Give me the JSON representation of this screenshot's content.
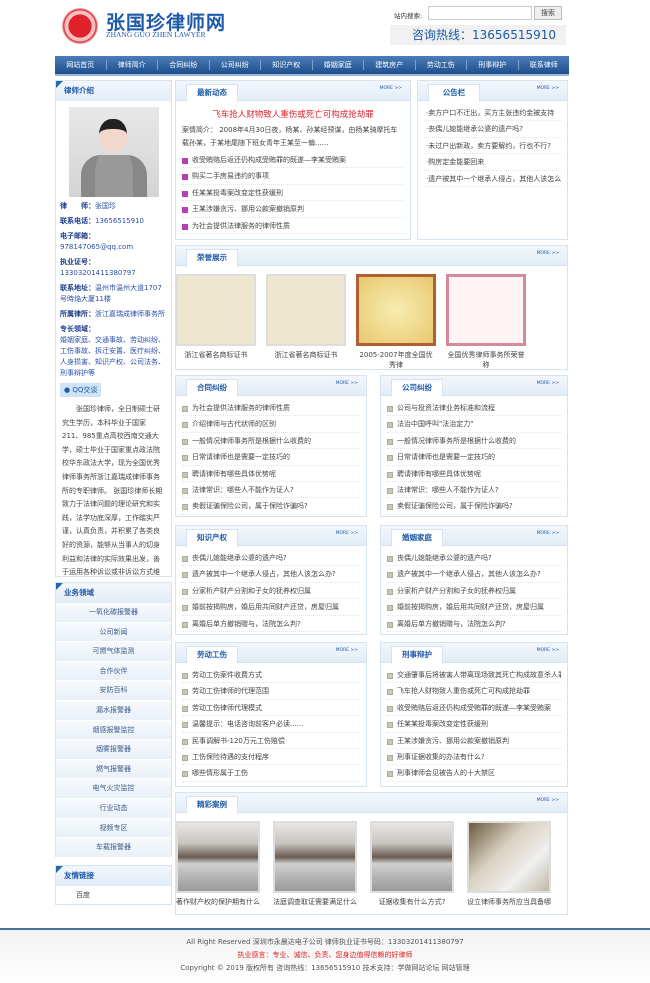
{
  "header": {
    "title": "张国珍律师网",
    "subtitle": "ZHANG GUO ZHEN LAWYER",
    "search_label": "站内搜索:",
    "search_value": "",
    "search_button": "搜索",
    "hotline": "咨询热线：13656515910"
  },
  "nav": [
    "网站首页",
    "律师简介",
    "合同纠纷",
    "公司纠纷",
    "知识产权",
    "婚姻家庭",
    "建筑房产",
    "劳动工伤",
    "刑事辩护",
    "联系律师"
  ],
  "sidebar": {
    "intro_title": "律师介绍",
    "info": [
      {
        "label": "律　　师：",
        "value": "张国珍"
      },
      {
        "label": "联系电话：",
        "value": "13656515910"
      },
      {
        "label": "电子邮箱：",
        "value": "978147065@qq.com"
      },
      {
        "label": "执业证号：",
        "value": "13303201411380797"
      },
      {
        "label": "联系地址：",
        "value": "温州市温州大道1707号時焔大厦11楼"
      },
      {
        "label": "所属律所：",
        "value": "浙江嘉瑞成律师事务所"
      },
      {
        "label": "专长领域：",
        "value": "婚姻家庭、交通事故、劳动纠纷、工伤事故、拆迁安置、医疗纠纷、人身损害、知识产权、公司法务、刑事辩护等"
      }
    ],
    "qq_label": "QQ交谈",
    "bio": "张国珍律师，全日制硕士研究生学历，本科毕业于国家211、985重点高校西南交通大学，硕士毕业于国家重点政法院校华东政法大学，现为全国优秀律师事务所浙江嘉瑞成律师事务所的专职律师。 张国珍律师长期致力于法律问题的理论研究和实践，法学功底深厚，工作踏实严谨，认真负责，并积累了各类良好的资源，能够从当事人的切身利益和法律的实际效果出发，善于运用各种诉讼或非诉讼方式维护当事人的合法权益，并力图将当事人的利益最大化。",
    "business_title": "业务领域",
    "business": [
      "一氧化碳报警器",
      "公司新闻",
      "可燃气体监测",
      "合作伙伴",
      "安防百科",
      "漏水报警器",
      "烟感报警监控",
      "烟雾报警器",
      "燃气报警器",
      "电气火灾监控",
      "行业动态",
      "视频专区",
      "车载报警器"
    ],
    "links_title": "友情链接",
    "links": [
      "百度"
    ]
  },
  "more": "MORE >>",
  "news": {
    "title": "最新动态",
    "headline": "飞车抢人财物致人重伤或死亡可构成抢劫罪",
    "summary": "案情简介： 2008年4月30日夜，杨某、孙某经预谋，由杨某骑摩托车载孙某，于某地尾随下班女青年王某至一偏......",
    "items": [
      "收受贿赂后返还仍构成受贿罪的既遂—李某受贿案",
      "购买二手房易违约的事项",
      "任某某投毒案改变定性获缓刑",
      "王某涉嫌贪污、挪用公款案撤销原判",
      "为社会提供法律服务的律师性质"
    ]
  },
  "notice": {
    "title": "公告栏",
    "items": [
      "·卖方户口不迁出，买方主张违约金被支持",
      "·丧偶儿媳能继承公婆的遗产吗?",
      "·未过户出新政，卖方要解约，行也不行?",
      "·购房定金能要回来",
      "·遗产被其中一个继承人侵占，其他人该怎么办?"
    ]
  },
  "honors": {
    "title": "荣誉展示",
    "items": [
      "浙江省著名商标证书",
      "浙江省著名商标证书",
      "2005-2007年度全国优秀律",
      "全国优秀律师事务所荣誉称"
    ]
  },
  "sections": [
    {
      "title": "合同纠纷",
      "items": [
        "为社会提供法律服务的律师性质",
        "介绍律师与古代状师的区别",
        "一般情况律师事务所是根据什么收费的",
        "日常请律师也是需要一定技巧的",
        "聘请律师有哪些具体优势呢",
        "法律常识：哪些人不能作为证人?",
        "卖假证骗保险公司，属于保险诈骗吗?"
      ]
    },
    {
      "title": "公司纠纷",
      "items": [
        "公司与投资法律业务标准和流程",
        "法治中国呼叫\"法治定力\"",
        "一般情况律师事务所是根据什么收费的",
        "日常请律师也是需要一定技巧的",
        "聘请律师有哪些具体优势呢",
        "法律常识：哪些人不能作为证人?",
        "卖假证骗保险公司，属于保险诈骗吗?"
      ]
    },
    {
      "title": "知识产权",
      "items": [
        "丧偶儿媳能继承公婆的遗产吗?",
        "遗产被其中一个继承人侵占，其他人该怎么办?",
        "分家析产财产分割和子女的抚养权归属",
        "婚前按揭购房，婚后用共同财产还贷，房屋归属",
        "离婚后单方撤销赠与，法院怎么判?"
      ]
    },
    {
      "title": "婚姻家庭",
      "items": [
        "丧偶儿媳能继承公婆的遗产吗?",
        "遗产被其中一个继承人侵占，其他人该怎么办?",
        "分家析产财产分割和子女的抚养权归属",
        "婚前按揭购房，婚后用共同财产还贷，房屋归属",
        "离婚后单方撤销赠与，法院怎么判?"
      ]
    },
    {
      "title": "劳动工伤",
      "items": [
        "劳动工伤案件收费方式",
        "劳动工伤律师的代理范围",
        "劳动工伤律师代理模式",
        "温馨提示：电话咨询前客户必读......",
        "民事调解书-120万元工伤赔偿",
        "工伤保险待遇的支付程序",
        "哪些情形属于工伤"
      ]
    },
    {
      "title": "刑事辩护",
      "items": [
        "交通肇事后将被害人带离现场致其死亡构成故意杀人罪",
        "飞车抢人财物致人重伤或死亡可构成抢劫罪",
        "收受贿赂后返还仍构成受贿罪的既遂—李某受贿案",
        "任某某投毒案改变定性获缓刑",
        "王某涉嫌贪污、挪用公款案撤销原判",
        "刑事证据收集的办法有什么?",
        "刑事律师会见被告人的十大禁区"
      ]
    }
  ],
  "cases": {
    "title": "精彩案例",
    "items": [
      "著作财产权的保护期有什么",
      "法庭调查取证需要满足什么",
      "证据收集有什么方式?",
      "设立律师事务所应当具备哪"
    ]
  },
  "footer": {
    "line1": "All Right Reserved 深圳市永晨达电子公司 律师执业证书号码：13303201411380797",
    "line2": "执业感言：专业、诚信、负责、您身边值得信赖的好律师",
    "line3": "Copyright © 2019 版权所有 咨询热线：13656515910 技术支持：学做网站论坛 网站管理"
  },
  "colors": {
    "brand": "#1e5aa8",
    "headline": "#e0202a",
    "nav": "#2a5c98"
  }
}
